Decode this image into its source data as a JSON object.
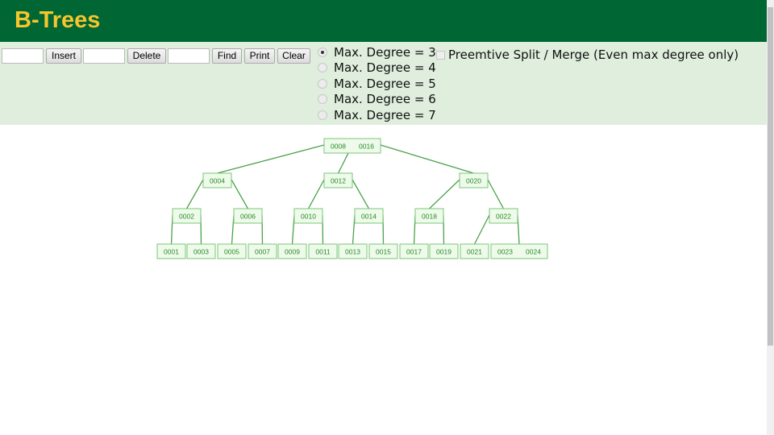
{
  "header": {
    "title": "B-Trees"
  },
  "controls": {
    "insert_value": "",
    "insert_label": "Insert",
    "delete_value": "",
    "delete_label": "Delete",
    "find_value": "",
    "find_label": "Find",
    "print_label": "Print",
    "clear_label": "Clear",
    "degrees": [
      {
        "label": "Max. Degree = 3",
        "selected": true
      },
      {
        "label": "Max. Degree = 4",
        "selected": false
      },
      {
        "label": "Max. Degree = 5",
        "selected": false
      },
      {
        "label": "Max. Degree = 6",
        "selected": false
      },
      {
        "label": "Max. Degree = 7",
        "selected": false
      }
    ],
    "preemptive_label": "Preemtive Split / Merge (Even max degree only)",
    "preemptive_checked": false
  },
  "colors": {
    "header": "#006633",
    "title": "#f7c52c",
    "panel": "#dfeedd",
    "node_fill": "#eefbea",
    "node_stroke": "#7cc47a",
    "edge": "#4aa24a",
    "key_text": "#2a8a2a"
  },
  "tree": {
    "root": {
      "keys": [
        "0008",
        "0016"
      ],
      "children": [
        {
          "keys": [
            "0004"
          ],
          "children": [
            {
              "keys": [
                "0002"
              ],
              "children": [
                {
                  "keys": [
                    "0001"
                  ]
                },
                {
                  "keys": [
                    "0003"
                  ]
                }
              ]
            },
            {
              "keys": [
                "0006"
              ],
              "children": [
                {
                  "keys": [
                    "0005"
                  ]
                },
                {
                  "keys": [
                    "0007"
                  ]
                }
              ]
            }
          ]
        },
        {
          "keys": [
            "0012"
          ],
          "children": [
            {
              "keys": [
                "0010"
              ],
              "children": [
                {
                  "keys": [
                    "0009"
                  ]
                },
                {
                  "keys": [
                    "0011"
                  ]
                }
              ]
            },
            {
              "keys": [
                "0014"
              ],
              "children": [
                {
                  "keys": [
                    "0013"
                  ]
                },
                {
                  "keys": [
                    "0015"
                  ]
                }
              ]
            }
          ]
        },
        {
          "keys": [
            "0020"
          ],
          "children": [
            {
              "keys": [
                "0018"
              ],
              "children": [
                {
                  "keys": [
                    "0017"
                  ]
                },
                {
                  "keys": [
                    "0019"
                  ]
                }
              ]
            },
            {
              "keys": [
                "0022"
              ],
              "children": [
                {
                  "keys": [
                    "0021"
                  ]
                },
                {
                  "keys": [
                    "0023",
                    "0024"
                  ]
                }
              ]
            }
          ]
        }
      ]
    }
  }
}
